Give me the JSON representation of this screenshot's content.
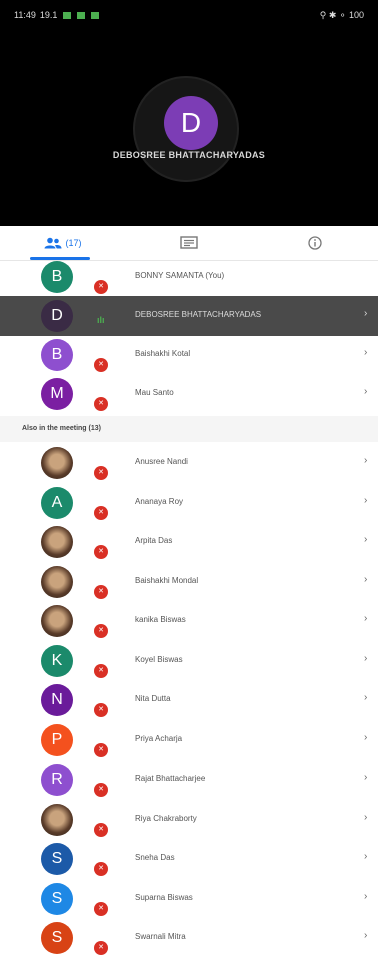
{
  "status_bar": {
    "time": "11:49",
    "extra": "19.1",
    "right_text": "⚲ ✱ ⚬ 100"
  },
  "main_speaker": {
    "initial": "D",
    "name": "DEBOSREE BHATTACHARYADAS",
    "avatar_color": "#7c3db5"
  },
  "tabs": {
    "people_label": "(17)",
    "people_icon": "people-icon",
    "chat_icon": "chat-icon",
    "info_icon": "info-icon",
    "accent_color": "#1a73e8"
  },
  "top_participants": [
    {
      "initial": "B",
      "name": "BONNY SAMANTA (You)",
      "color": "#1b8a6b",
      "muted": true
    },
    {
      "initial": "D",
      "name": "DEBOSREE BHATTACHARYADAS",
      "color": "#3a2b45",
      "muted": false,
      "speaking": true
    },
    {
      "initial": "B",
      "name": "Baishakhi Kotal",
      "color": "#8e4fcf",
      "muted": true
    },
    {
      "initial": "M",
      "name": "Mau Santo",
      "color": "#7b1fa2",
      "muted": true
    }
  ],
  "also_section": {
    "title": "Also in the meeting (13)"
  },
  "also_participants": [
    {
      "initial": "",
      "name": "Anusree Nandi",
      "photo": true,
      "muted": true
    },
    {
      "initial": "A",
      "name": "Ananaya Roy",
      "color": "#1b8a6b",
      "muted": true
    },
    {
      "initial": "",
      "name": "Arpita Das",
      "photo": true,
      "muted": true
    },
    {
      "initial": "",
      "name": "Baishakhi Mondal",
      "photo": true,
      "muted": true
    },
    {
      "initial": "",
      "name": "kanika Biswas",
      "photo": true,
      "muted": true
    },
    {
      "initial": "K",
      "name": "Koyel Biswas",
      "color": "#1b8a6b",
      "muted": true
    },
    {
      "initial": "N",
      "name": "Nita Dutta",
      "color": "#6a1b9a",
      "muted": true
    },
    {
      "initial": "P",
      "name": "Priya Acharja",
      "color": "#f4511e",
      "muted": true
    },
    {
      "initial": "R",
      "name": "Rajat Bhattacharjee",
      "color": "#8e4fcf",
      "muted": true
    },
    {
      "initial": "",
      "name": "Riya Chakraborty",
      "photo": true,
      "muted": true
    },
    {
      "initial": "S",
      "name": "Sneha Das",
      "color": "#1c5aa8",
      "muted": true
    },
    {
      "initial": "S",
      "name": "Suparna Biswas",
      "color": "#1e88e5",
      "muted": true
    },
    {
      "initial": "S",
      "name": "Swarnali Mitra",
      "color": "#d84315",
      "muted": true
    }
  ]
}
